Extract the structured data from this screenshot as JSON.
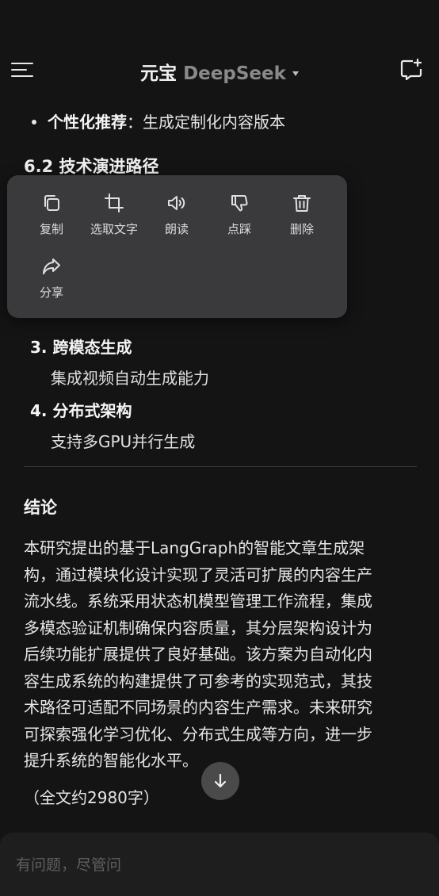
{
  "header": {
    "brand": "元宝",
    "model": "DeepSeek"
  },
  "content": {
    "bullet": {
      "strong": "个性化推荐",
      "rest": "：生成定制化内容版本"
    },
    "section_heading": "6.2 技术演进路径",
    "items": [
      {
        "title": "3. 跨模态生成",
        "desc": "集成视频自动生成能力"
      },
      {
        "title": "4. 分布式架构",
        "desc": "支持多GPU并行生成"
      }
    ],
    "conclusion_title": "结论",
    "conclusion_lines": [
      "本研究提出的基于LangGraph的智能文章生成架",
      "构，通过模块化设计实现了灵活可扩展的内容生产",
      "流水线。系统采用状态机模型管理工作流程，集成",
      "多模态验证机制确保内容质量，其分层架构设计为",
      "后续功能扩展提供了良好基础。该方案为自动化内",
      "容生成系统的构建提供了可参考的实现范式，其技",
      "术路径可适配不同场景的内容生产需求。未来研究",
      "可探索强化学习优化、分布式生成等方向，进一步",
      "提升系统的智能化水平。"
    ],
    "word_count": "（全文约2980字）"
  },
  "context_menu": {
    "items": [
      {
        "label": "复制",
        "icon": "copy-icon"
      },
      {
        "label": "选取文字",
        "icon": "crop-icon"
      },
      {
        "label": "朗读",
        "icon": "speaker-icon"
      },
      {
        "label": "点踩",
        "icon": "thumbs-down-icon"
      },
      {
        "label": "删除",
        "icon": "trash-icon"
      },
      {
        "label": "分享",
        "icon": "share-icon"
      }
    ]
  },
  "input": {
    "placeholder": "有问题，尽管问"
  },
  "colors": {
    "background": "#141414",
    "menu_bg": "#3a3a3c",
    "text": "#e6e6e6",
    "muted": "#8a8a8a"
  }
}
